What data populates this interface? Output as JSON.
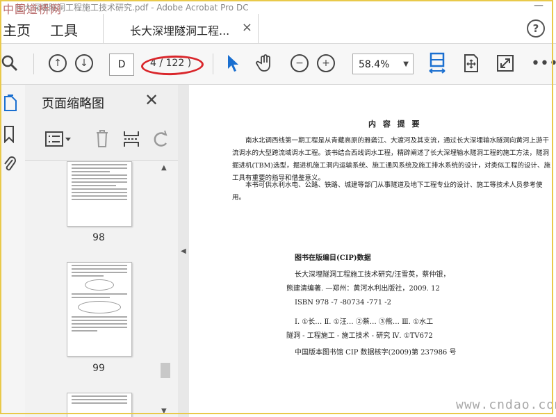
{
  "window": {
    "title": "长大深埋隧洞工程施工技术研究.pdf - Adobe Acrobat Pro DC",
    "minimize": "—"
  },
  "watermark_top": "中国道桥网",
  "watermark_bottom": "www.cndao.com",
  "tabs": {
    "home": "主页",
    "tools": "工具",
    "document": "长大深埋隧洞工程...",
    "close": "×"
  },
  "help": "?",
  "toolbar": {
    "page_input": "D",
    "page_count": "4 / 122 )",
    "zoom": "58.4%",
    "icons": [
      "search-icon",
      "page-up-icon",
      "page-down-icon",
      "select-cursor-icon",
      "hand-icon",
      "zoom-out-icon",
      "zoom-in-icon",
      "fit-width-icon",
      "page-display-icon",
      "full-screen-icon",
      "more-icon"
    ],
    "accent_color": "#1a6fd0",
    "highlight_color": "#d9262b"
  },
  "sidebar": {
    "title": "页面缩略图",
    "thumbnails": [
      {
        "label": "98"
      },
      {
        "label": "99"
      }
    ]
  },
  "document": {
    "abstract_title": "内 容 提 要",
    "paragraphs": [
      "南水北调西线第一期工程是从青藏高原的雅砻江、大渡河及其支流，通过长大深埋输水隧洞向黄河上游干流调水的大型跨流域调水工程。该书结合西线调水工程，精辟阐述了长大深埋输水隧洞工程的施工方法，隧洞掘进机(TBM)选型，掘进机施工洞内运输系统、施工通风系统及施工排水系统的设计，对类似工程的设计、施工具有重要的指导和借鉴意义。",
      "本书可供水利水电、公路、铁路、城建等部门从事隧道及地下工程专业的设计、施工等技术人员参考使用。"
    ],
    "cip_title": "图书在版编目(CIP)数据",
    "cip_lines": [
      "长大深埋隧洞工程施工技术研究/汪雪英，蔡仲银，",
      "熊建清编著. —郑州：黄河水利出版社，2009. 12",
      "ISBN 978 -7 -80734 -771 -2"
    ],
    "class_lines": [
      "Ⅰ. ①长…   Ⅱ. ①汪… ②蔡… ③熊…   Ⅲ. ①水工",
      "隧洞 - 工程施工 - 施工技术 - 研究   Ⅳ. ①TV672"
    ],
    "cip_number": "中国版本图书馆 CIP 数据核字(2009)第 237986 号"
  }
}
